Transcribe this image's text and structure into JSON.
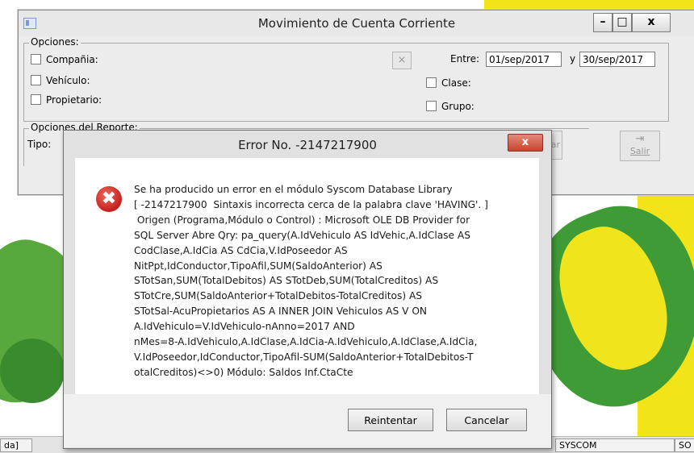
{
  "main_window": {
    "title": "Movimiento de Cuenta Corriente",
    "minimize_glyph": "–",
    "maximize_glyph": "□",
    "close_glyph": "x",
    "options_group": {
      "caption": "Opciones:",
      "checkboxes": [
        "Compañia:",
        "Vehículo:",
        "Propietario:",
        "Clase:",
        "Grupo:"
      ],
      "filter_icon": "filter-clear-icon",
      "between_label": "Entre:",
      "date_from": "01/sep/2017",
      "and_label": "y",
      "date_to": "30/sep/2017"
    },
    "report_options": {
      "caption": "Opciones del Reporte:",
      "type_label": "Tipo:"
    },
    "partial_button_label": "ar",
    "exit_button_label": "Salir",
    "exit_icon": "door-exit-icon"
  },
  "status_bar": {
    "cells": [
      "da]",
      "SYSCOM",
      "SO"
    ]
  },
  "error_dialog": {
    "title": "Error No. -2147217900",
    "close_glyph": "x",
    "icon": "error-icon",
    "message_lines": [
      "Se ha producido un error en el módulo Syscom Database Library",
      "[ -2147217900  Sintaxis incorrecta cerca de la palabra clave 'HAVING'. ]",
      " Origen (Programa,Módulo o Control) : Microsoft OLE DB Provider for",
      "SQL Server Abre Qry: pa_query(A.IdVehiculo AS IdVehic,A.IdClase AS",
      "CodClase,A.IdCia AS CdCia,V.IdPoseedor AS",
      "NitPpt,IdConductor,TipoAfil,SUM(SaldoAnterior) AS",
      "STotSan,SUM(TotalDebitos) AS STotDeb,SUM(TotalCreditos) AS",
      "STotCre,SUM(SaldoAnterior+TotalDebitos-TotalCreditos) AS",
      "STotSal-AcuPropietarios AS A INNER JOIN Vehiculos AS V ON",
      "A.IdVehiculo=V.IdVehiculo-nAnno=2017 AND",
      "nMes=8-A.IdVehiculo,A.IdClase,A.IdCia-A.IdVehiculo,A.IdClase,A.IdCia,",
      "V.IdPoseedor,IdConductor,TipoAfil-SUM(SaldoAnterior+TotalDebitos-T",
      "otalCreditos)<>0) Módulo: Saldos Inf.CtaCte"
    ],
    "retry_label": "Reintentar",
    "cancel_label": "Cancelar"
  },
  "colors": {
    "desktop_yellow": "#f2e419",
    "desktop_green": "#3f9b35",
    "dialog_close_red": "#c8452f",
    "error_icon_red": "#c41f1f"
  }
}
